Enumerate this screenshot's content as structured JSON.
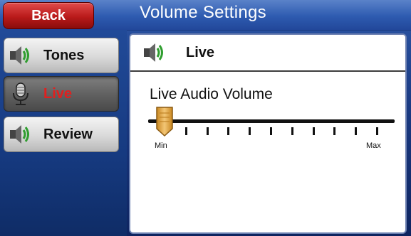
{
  "header": {
    "back_label": "Back",
    "title": "Volume Settings"
  },
  "nav": {
    "items": [
      {
        "label": "Tones",
        "icon": "speaker-icon",
        "active": false
      },
      {
        "label": "Live",
        "icon": "microphone-icon",
        "active": true
      },
      {
        "label": "Review",
        "icon": "speaker-icon",
        "active": false
      }
    ]
  },
  "content": {
    "header_title": "Live",
    "header_icon": "speaker-icon",
    "slider": {
      "label": "Live Audio Volume",
      "min_label": "Min",
      "max_label": "Max",
      "tick_count": 11,
      "value_fraction": 0.0
    }
  },
  "colors": {
    "back_button": "#b91a1a",
    "active_label": "#e0201f",
    "thumb": "#e0a640",
    "title_bar": "#2e5bb0"
  }
}
